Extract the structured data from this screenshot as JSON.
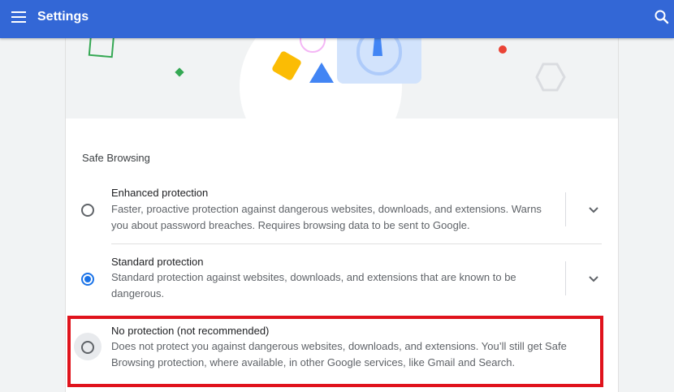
{
  "header": {
    "title": "Settings"
  },
  "section": {
    "title": "Safe Browsing"
  },
  "options": [
    {
      "label": "Enhanced protection",
      "desc_line1": "Faster, proactive protection against dangerous websites, downloads, and extensions. Warns",
      "desc_line2": "you about password breaches. Requires browsing data to be sent to Google.",
      "selected": false
    },
    {
      "label": "Standard protection",
      "desc_line1": "Standard protection against websites, downloads, and extensions that are known to be",
      "desc_line2": "dangerous.",
      "selected": true
    },
    {
      "label": "No protection (not recommended)",
      "desc_line1": "Does not protect you against dangerous websites, downloads, and extensions. You’ll still get Safe",
      "desc_line2": "Browsing protection, where available, in other Google services, like Gmail and Search.",
      "selected": false
    }
  ],
  "colors": {
    "header": "#3367d6",
    "accent": "#1a73e8",
    "highlight": "#e0131c"
  },
  "icons": {
    "menu": "menu-icon",
    "search": "search-icon",
    "expand": "chevron-down-icon"
  }
}
